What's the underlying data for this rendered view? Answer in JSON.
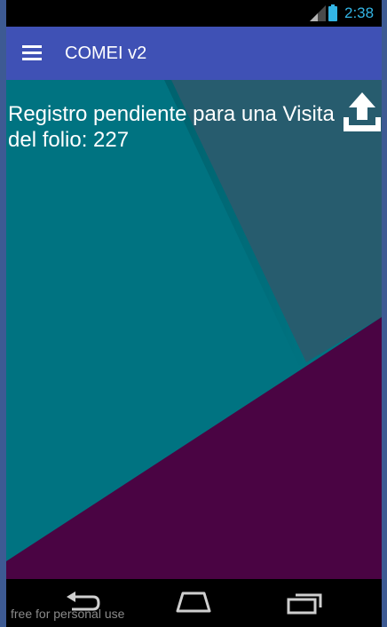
{
  "status_bar": {
    "time": "2:38",
    "signal_icon": "signal-icon",
    "battery_icon": "battery-icon",
    "accent_color": "#33b5e5"
  },
  "app_bar": {
    "title": "COMEI v2",
    "menu_icon": "menu-icon",
    "background_color": "#3f51b5"
  },
  "content": {
    "message": "Registro pendiente para una Visita del folio: 227",
    "upload_icon": "upload-icon",
    "colors": {
      "teal": "#007381",
      "slate": "#275c6e",
      "purple": "#4a0443"
    }
  },
  "nav_bar": {
    "icons": [
      "back-icon",
      "home-icon",
      "recents-icon"
    ],
    "watermark": "free for personal use"
  }
}
